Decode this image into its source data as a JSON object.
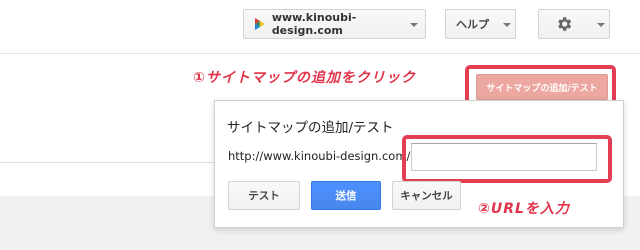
{
  "header": {
    "site_selector_label": "www.kinoubi-design.com",
    "help_label": "ヘルプ",
    "settings_icon": "gear-icon",
    "dropdown_icon": "chevron-down-icon"
  },
  "annotations": {
    "step1": "①サイトマップの追加をクリック",
    "step2": "②URLを入力",
    "highlight_color": "#e23f55"
  },
  "toolbar": {
    "add_test_label": "サイトマップの追加/テスト"
  },
  "dialog": {
    "title": "サイトマップの追加/テスト",
    "url_prefix": "http://www.kinoubi-design.com/",
    "url_value": "",
    "buttons": {
      "test": "テスト",
      "submit": "送信",
      "cancel": "キャンセル"
    }
  },
  "colors": {
    "primary_blue": "#4d90fe",
    "add_button_fill": "#eba7a0"
  }
}
